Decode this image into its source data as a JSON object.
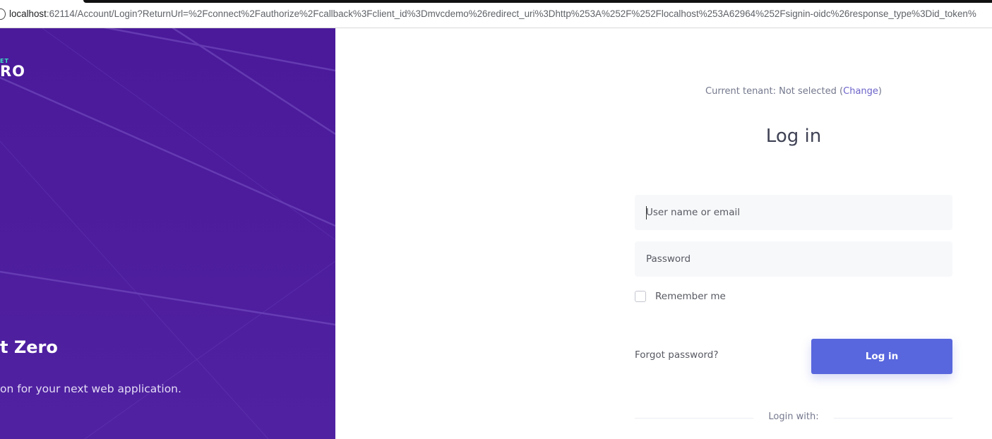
{
  "browser": {
    "url_host": "localhost",
    "url_rest": ":62114/Account/Login?ReturnUrl=%2Fconnect%2Fauthorize%2Fcallback%3Fclient_id%3Dmvcdemo%26redirect_uri%3Dhttp%253A%252F%252Flocalhost%253A62964%252Fsignin-oidc%26response_type%3Did_token%"
  },
  "hero": {
    "logo_small": "ET",
    "logo_big": "RO",
    "title": "t Zero",
    "subtitle": "on for your next web application.",
    "colors": {
      "background": "#4b1b9b",
      "logo_accent": "#3ae0c0"
    }
  },
  "login": {
    "tenant_prefix": "Current tenant: Not selected (",
    "tenant_change": "Change",
    "tenant_suffix": ")",
    "heading": "Log in",
    "username_placeholder": "User name or email",
    "password_placeholder": "Password",
    "remember_label": "Remember me",
    "forgot_label": "Forgot password?",
    "login_button": "Log in",
    "login_with": "Login with:",
    "colors": {
      "primary_button": "#5867dd",
      "link": "#6c63c9",
      "input_bg": "#f7f8fa"
    }
  }
}
